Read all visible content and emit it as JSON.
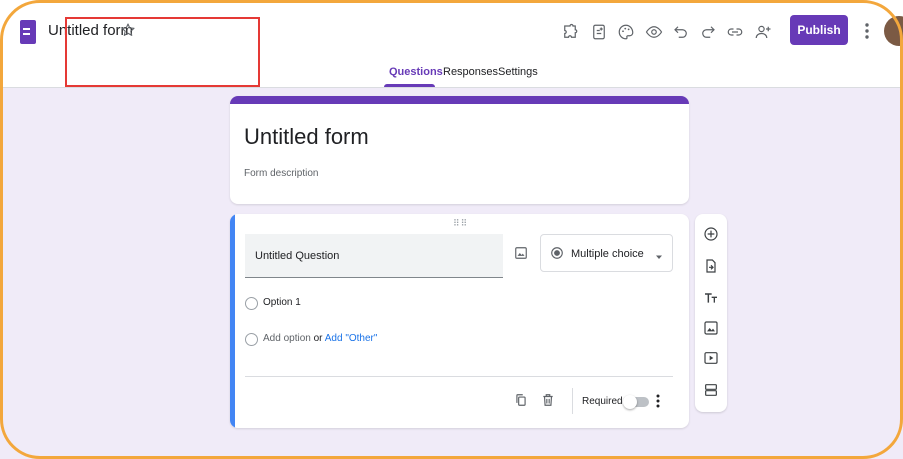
{
  "header": {
    "doc_title": "Untitled form",
    "publish_label": "Publish",
    "toolbar_icons": [
      "addon-icon",
      "customize-theme-icon",
      "palette-icon",
      "preview-icon",
      "undo-icon",
      "redo-icon",
      "link-icon",
      "add-collaborator-icon"
    ]
  },
  "tabs": [
    {
      "label": "Questions",
      "active": true
    },
    {
      "label": "Responses",
      "active": false
    },
    {
      "label": "Settings",
      "active": false
    }
  ],
  "form": {
    "title": "Untitled form",
    "description_placeholder": "Form description"
  },
  "question": {
    "title": "Untitled Question",
    "type": "Multiple choice",
    "options": [
      "Option 1"
    ],
    "add_option_label": "Add option",
    "or_label": "or",
    "add_other_label": "Add \"Other\"",
    "required_label": "Required",
    "required": false
  },
  "colors": {
    "accent": "#673ab7",
    "canvas": "#f0ebf8",
    "active_card_bar": "#4285f4",
    "frame": "#f3a73c",
    "highlight": "#e53935"
  }
}
